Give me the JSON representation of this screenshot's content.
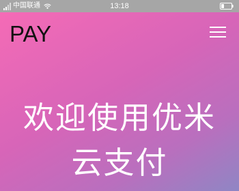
{
  "status_bar": {
    "carrier": "中国联通",
    "time": "13:18",
    "icons": [
      "signal-icon",
      "wifi-icon",
      "battery-icon"
    ]
  },
  "header": {
    "brand": "PAY",
    "menu_icon": "hamburger-menu-icon"
  },
  "hero": {
    "welcome_line1": "欢迎使用优米",
    "welcome_line2": "云支付"
  },
  "colors": {
    "status_bar_bg": "#a6a6a6",
    "gradient_start": "#f56bb6",
    "gradient_end": "#8f86c4",
    "text_light": "#ffffff",
    "text_dark": "#111111"
  }
}
